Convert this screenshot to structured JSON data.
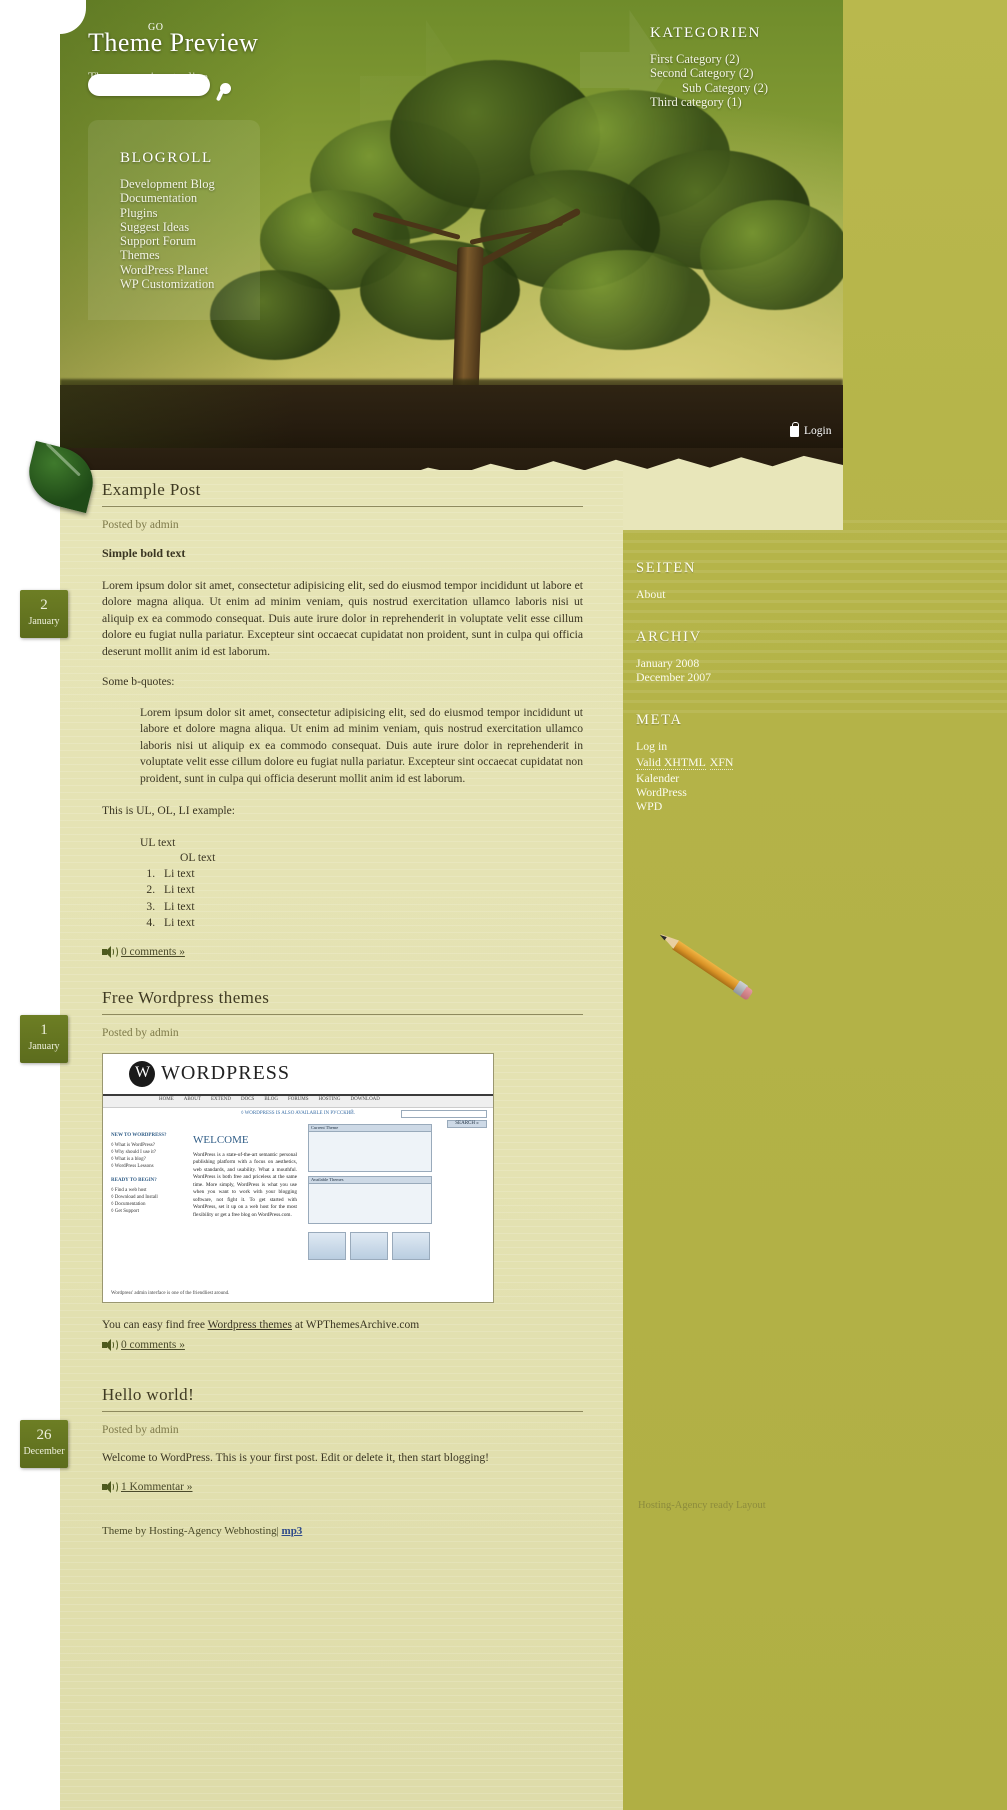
{
  "header": {
    "site_title": "Theme Preview",
    "tagline": "Theme preview tagline",
    "search_placeholder": "",
    "search_value": "",
    "go_label": "GO",
    "login_label": "Login"
  },
  "blogroll": {
    "title": "BLOGROLL",
    "items": [
      "Development Blog",
      "Documentation",
      "Plugins",
      "Suggest Ideas",
      "Support Forum",
      "Themes",
      "WordPress Planet",
      "WP Customization"
    ]
  },
  "categories": {
    "title": "KATEGORIEN",
    "items": [
      {
        "label": "First Category (2)",
        "sub": false
      },
      {
        "label": "Second Category (2)",
        "sub": false
      },
      {
        "label": "Sub Category (2)",
        "sub": true
      },
      {
        "label": "Third category (1)",
        "sub": false
      }
    ]
  },
  "posts": [
    {
      "title": "Example Post",
      "meta": "Posted by admin",
      "date_day": "2",
      "date_month": "January",
      "bold_text": "Simple bold text",
      "para1": "Lorem ipsum dolor sit amet, consectetur adipisicing elit, sed do eiusmod tempor incididunt ut labore et dolore magna aliqua. Ut enim ad minim veniam, quis nostrud exercitation ullamco laboris nisi ut aliquip ex ea commodo consequat. Duis aute irure dolor in reprehenderit in voluptate velit esse cillum dolore eu fugiat nulla pariatur. Excepteur sint occaecat cupidatat non proident, sunt in culpa qui officia deserunt mollit anim id est laborum.",
      "para2": "Some b-quotes:",
      "blockquote": "Lorem ipsum dolor sit amet, consectetur adipisicing elit, sed do eiusmod tempor incididunt ut labore et dolore magna aliqua. Ut enim ad minim veniam, quis nostrud exercitation ullamco laboris nisi ut aliquip ex ea commodo consequat. Duis aute irure dolor in reprehenderit in voluptate velit esse cillum dolore eu fugiat nulla pariatur. Excepteur sint occaecat cupidatat non proident, sunt in culpa qui officia deserunt mollit anim id est laborum.",
      "para3": "This is UL, OL, LI example:",
      "ul_text": "UL text",
      "ol_text": "OL text",
      "li_items": [
        "Li text",
        "Li text",
        "Li text",
        "Li text"
      ],
      "comments": "0 comments »"
    },
    {
      "title": "Free Wordpress themes",
      "meta": "Posted by admin",
      "date_day": "1",
      "date_month": "January",
      "caption_pre": "You can easy find free ",
      "caption_link": "Wordpress themes",
      "caption_post": " at WPThemesArchive.com",
      "comments": "0 comments »",
      "screenshot": {
        "brand": "WORDPRESS",
        "nav": [
          "HOME",
          "ABOUT",
          "EXTEND",
          "DOCS",
          "BLOG",
          "FORUMS",
          "HOSTING",
          "DOWNLOAD"
        ],
        "notice": "◊ WORDPRESS IS ALSO AVAILABLE IN РУССКИЙ.",
        "search_button": "SEARCH »",
        "welcome": "WELCOME",
        "left_col_title": "NEW TO WORDPRESS?",
        "left_col_items": [
          "◊ What is WordPress?",
          "◊ Why should I use it?",
          "◊ What is a blog?",
          "◊ WordPress Lessons"
        ],
        "left_col_title2": "READY TO BEGIN?",
        "left_col_items2": [
          "◊ Find a web host",
          "◊ Download and Install",
          "◊ Documentation",
          "◊ Get Support"
        ],
        "body_text": "WordPress is a state-of-the-art semantic personal publishing platform with a focus on aesthetics, web standards, and usability. What a mouthful. WordPress is both free and priceless at the same time.  More simply, WordPress is what you use when you want to work with your blogging software, not fight it.  To get started with WordPress, set it up on a web host for the most flexibility or get a free blog on WordPress.com.",
        "panel_title": "Current Theme",
        "panel_title2": "Available Themes",
        "caption": "Wordpress' admin interface is one of the friendliest around."
      }
    },
    {
      "title": "Hello world!",
      "meta": "Posted by admin",
      "date_day": "26",
      "date_month": "December",
      "para1": "Welcome to WordPress. This is your first post. Edit or delete it, then start blogging!",
      "comments": "1 Kommentar »"
    }
  ],
  "sidebar": {
    "widgets": [
      {
        "title": "SEITEN",
        "items": [
          {
            "label": "About",
            "dotted": false
          }
        ]
      },
      {
        "title": "ARCHIV",
        "items": [
          {
            "label": "January 2008",
            "dotted": false
          },
          {
            "label": "December 2007",
            "dotted": false
          }
        ]
      },
      {
        "title": "META",
        "items": [
          {
            "label": "Log in",
            "dotted": false
          },
          {
            "label": "Valid XHTML",
            "dotted": true
          },
          {
            "label": "XFN",
            "dotted": true
          },
          {
            "label": "Kalender",
            "dotted": false
          },
          {
            "label": "WordPress",
            "dotted": false
          },
          {
            "label": "WPD",
            "dotted": false
          }
        ]
      }
    ]
  },
  "footer": {
    "theme_by": "Theme by Hosting-Agency Webhosting",
    "separator": "| ",
    "link": "mp3",
    "hosting_note": "Hosting-Agency ready Layout"
  }
}
